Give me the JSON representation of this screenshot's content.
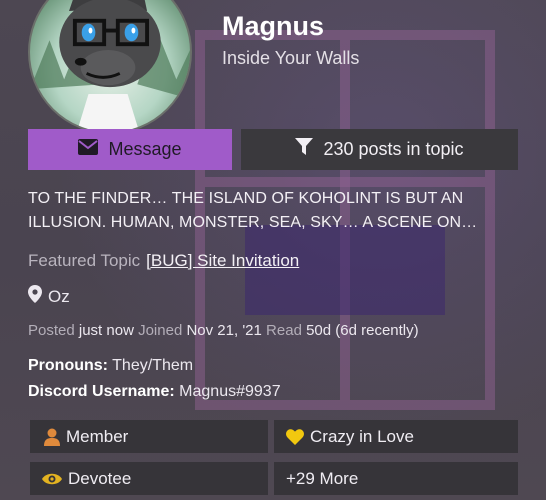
{
  "profile": {
    "name": "Magnus",
    "subtitle": "Inside Your Walls"
  },
  "actions": {
    "message_label": "Message",
    "posts_label": "230 posts in topic"
  },
  "bio": "TO THE FINDER… THE ISLAND OF KOHOLINT IS BUT AN ILLUSION. HUMAN, MONSTER, SEA, SKY… A SCENE ON…",
  "featured": {
    "label": "Featured Topic",
    "link": "[BUG] Site Invitation"
  },
  "location": "Oz",
  "meta": {
    "posted_label": "Posted",
    "posted_value": "just now",
    "joined_label": "Joined",
    "joined_value": "Nov 21, '21",
    "read_label": "Read",
    "read_value": "50d (6d recently)"
  },
  "fields": {
    "pronouns_label": "Pronouns:",
    "pronouns_value": "They/Them",
    "discord_label": "Discord Username:",
    "discord_value": "Magnus#9937"
  },
  "badges": [
    {
      "label": "Member",
      "icon": "user-icon",
      "color": "#e08a3c"
    },
    {
      "label": "Crazy in Love",
      "icon": "heart-icon",
      "color": "#f2c80f"
    },
    {
      "label": "Devotee",
      "icon": "eye-icon",
      "color": "#e3b321"
    },
    {
      "label": "+29 More"
    }
  ],
  "colors": {
    "accent": "#a05bc9",
    "button_dark": "#3a393d",
    "badge_bg": "#363439"
  }
}
